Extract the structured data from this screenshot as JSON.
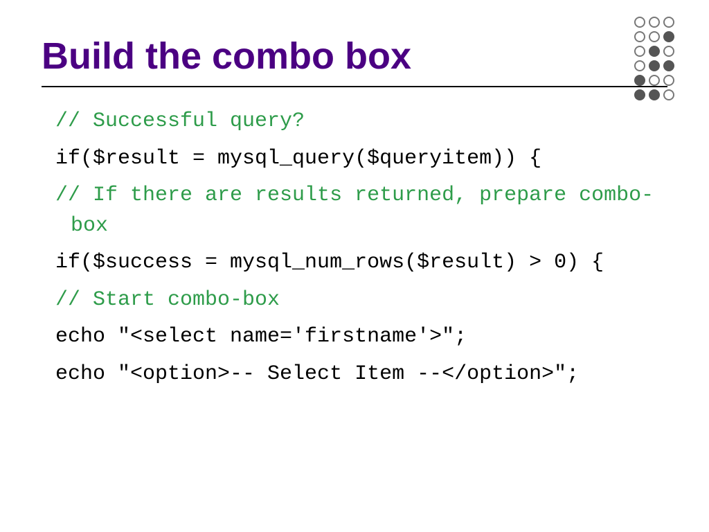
{
  "title": "Build the combo box",
  "lines": {
    "c1": "// Successful query?",
    "l1": "if($result = mysql_query($queryitem))  {",
    "c2": "// If there are results returned, prepare combo-box",
    "l2": "if($success = mysql_num_rows($result) > 0) {",
    "c3": "// Start combo-box",
    "l3": "echo \"<select name='firstname'>\";",
    "l4": "echo \"<option>-- Select Item --</option>\";"
  },
  "dot_pattern": [
    [
      0,
      0,
      0
    ],
    [
      0,
      0,
      1
    ],
    [
      0,
      1,
      0
    ],
    [
      0,
      1,
      1
    ],
    [
      1,
      0,
      0
    ],
    [
      1,
      1,
      0
    ]
  ],
  "colors": {
    "title": "#4B0082",
    "comment": "#2e9c4a",
    "code": "#000000"
  }
}
